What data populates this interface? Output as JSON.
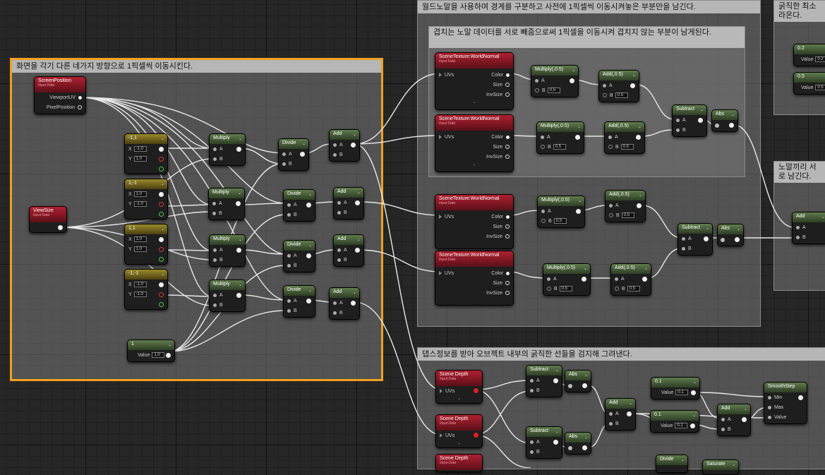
{
  "comments": {
    "c1_title": "화면을 각기 다른 네가지 방향으로 1픽셀씩 이동시킨다.",
    "c2_title": "월드노말을 사용하여 경계를 구분하고 사전에 1픽셀씩 이동시켜놓은 부분만을 남긴다.",
    "c3_title": "겹치는 노말 데이터를 서로 빼줌으로써 1픽셀을 이동시켜 겹치지 않는 부분이 남게된다.",
    "c4_title": "댑스정보를 받아 오브젝트 내부의 굵직한 선들을 검지해 그려낸다.",
    "c5_title": "굵직한 최소 라온다.",
    "c6_title": "노말끼리 서로 남긴다."
  },
  "nodes": {
    "screen_position": {
      "title": "ScreenPosition",
      "sub": "Input Data",
      "pin1": "ViewportUV",
      "pin2": "PixelPosition"
    },
    "view_size": {
      "title": "ViewSize",
      "sub": "Input Data"
    },
    "vec_a": {
      "title": "-1,1",
      "x": "-1.0",
      "y": "1.0"
    },
    "vec_b": {
      "title": "1,-1",
      "x": "1.0",
      "y": "-1.0"
    },
    "vec_c": {
      "title": "1,1",
      "x": "1.0",
      "y": "1.0"
    },
    "vec_d": {
      "title": "-1,-1",
      "x": "-1.0",
      "y": "-1.0"
    },
    "const_1": {
      "title": "1",
      "value_label": "Value",
      "value": "1.0"
    },
    "multiply": "Multiply",
    "divide": "Divide",
    "add": "Add",
    "pin_a": "A",
    "pin_b": "B",
    "scene_tex": {
      "title": "SceneTexture:WorldNormal",
      "sub": "Input Data",
      "uvs": "UVs",
      "color": "Color",
      "size": "Size",
      "invsize": "InvSize"
    },
    "multiply_05": "Multiply(,0.5)",
    "add_05": "Add(,0.5)",
    "b_value": "0.5",
    "subtract": "Subtract",
    "abs": "Abs",
    "scene_depth": {
      "title": "Scene Depth",
      "sub": "Input Data",
      "uvs": "UVs"
    },
    "const_01": {
      "title": "0.1",
      "value_label": "Value",
      "value": "0.1"
    },
    "const_02": {
      "title": "0.2",
      "value_label": "Value",
      "value": "0.2"
    },
    "const_05": {
      "title": "0.5",
      "value_label": "Value",
      "value": "0.5"
    },
    "smoothstep": {
      "title": "SmoothStep",
      "min": "Min",
      "max": "Max",
      "value": "Value"
    },
    "saturate": "Saturate"
  }
}
